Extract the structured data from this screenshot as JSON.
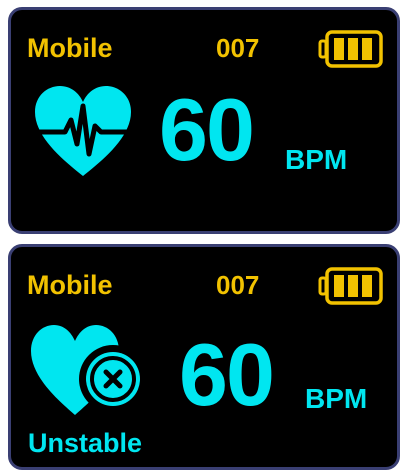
{
  "colors": {
    "background": "#000000",
    "border": "#3a3f73",
    "label": "#f2c200",
    "accent": "#00e6f0"
  },
  "panels": [
    {
      "mode": "Mobile",
      "device_id": "007",
      "battery_icon": "battery-full-icon",
      "battery_level": 1.0,
      "heart_icon": "heartbeat-icon",
      "bpm": "60",
      "unit": "BPM"
    },
    {
      "mode": "Mobile",
      "device_id": "007",
      "battery_icon": "battery-full-icon",
      "battery_level": 1.0,
      "heart_icon": "heart-unstable-icon",
      "bpm": "60",
      "unit": "BPM",
      "status": "Unstable"
    }
  ]
}
